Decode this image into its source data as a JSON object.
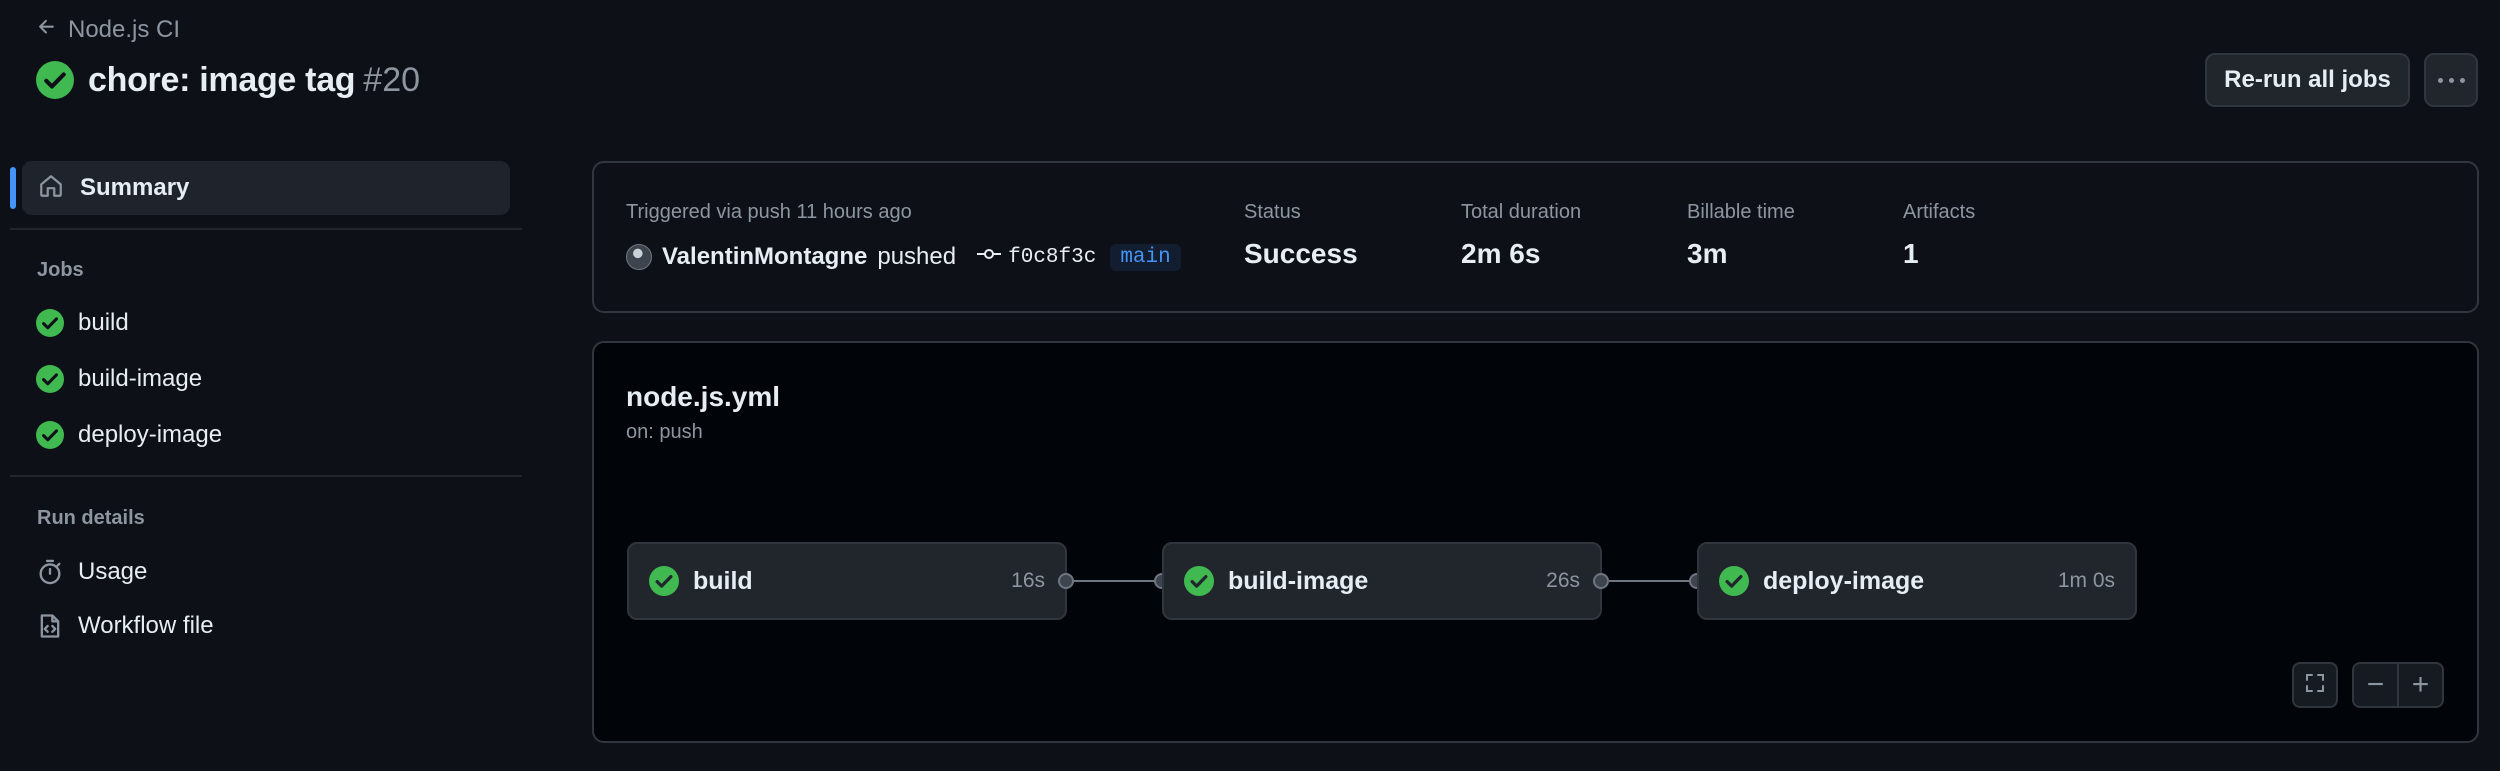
{
  "header": {
    "back_label": "Node.js CI",
    "run_title": "chore: image tag",
    "run_number": "#20",
    "rerun_label": "Re-run all jobs",
    "more_icon": "kebab-horizontal-icon"
  },
  "sidebar": {
    "summary_label": "Summary",
    "jobs_heading": "Jobs",
    "jobs": [
      {
        "label": "build",
        "status": "success"
      },
      {
        "label": "build-image",
        "status": "success"
      },
      {
        "label": "deploy-image",
        "status": "success"
      }
    ],
    "run_details_heading": "Run details",
    "details": [
      {
        "label": "Usage",
        "icon": "stopwatch-icon"
      },
      {
        "label": "Workflow file",
        "icon": "file-code-icon"
      }
    ]
  },
  "summary": {
    "trigger_text": "Triggered via push 11 hours ago",
    "actor": "ValentinMontagne",
    "action": "pushed",
    "commit_sha": "f0c8f3c",
    "branch": "main",
    "status_label": "Status",
    "status_value": "Success",
    "duration_label": "Total duration",
    "duration_value": "2m 6s",
    "billable_label": "Billable time",
    "billable_value": "3m",
    "artifacts_label": "Artifacts",
    "artifacts_value": "1"
  },
  "workflow": {
    "file_name": "node.js.yml",
    "trigger": "on: push",
    "jobs": [
      {
        "name": "build",
        "duration": "16s"
      },
      {
        "name": "build-image",
        "duration": "26s"
      },
      {
        "name": "deploy-image",
        "duration": "1m 0s"
      }
    ],
    "controls": {
      "fullscreen_icon": "screen-full-icon",
      "zoom_out": "−",
      "zoom_in": "+"
    }
  },
  "colors": {
    "background": "#0d1117",
    "success": "#3fb950",
    "accent": "#4493f8",
    "border": "#30363d"
  }
}
